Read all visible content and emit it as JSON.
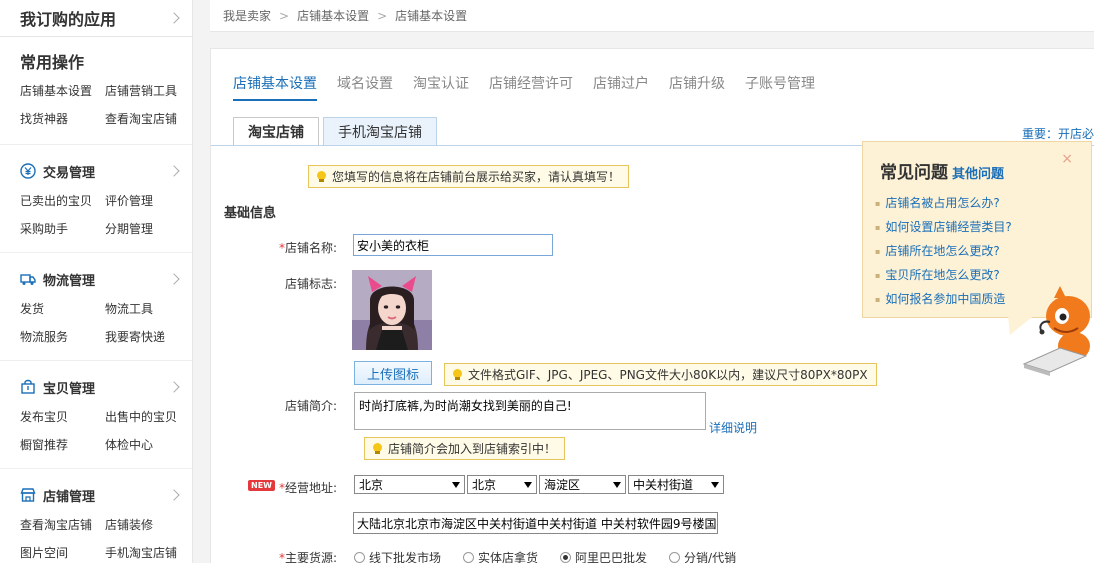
{
  "sidebar": {
    "top_title": "我订购的应用",
    "common_title": "常用操作",
    "common_links": [
      "店铺基本设置",
      "店铺营销工具",
      "找货神器",
      "查看淘宝店铺"
    ],
    "groups": [
      {
        "title": "交易管理",
        "icon": "yen-icon",
        "links": [
          "已卖出的宝贝",
          "评价管理",
          "采购助手",
          "分期管理"
        ]
      },
      {
        "title": "物流管理",
        "icon": "truck-icon",
        "links": [
          "发货",
          "物流工具",
          "物流服务",
          "我要寄快递"
        ]
      },
      {
        "title": "宝贝管理",
        "icon": "bag-icon",
        "links": [
          "发布宝贝",
          "出售中的宝贝",
          "橱窗推荐",
          "体检中心"
        ]
      },
      {
        "title": "店铺管理",
        "icon": "shop-icon",
        "links": [
          "查看淘宝店铺",
          "店铺装修",
          "图片空间",
          "手机淘宝店铺"
        ]
      }
    ]
  },
  "breadcrumb": [
    "我是卖家",
    "店铺基本设置",
    "店铺基本设置"
  ],
  "breadcrumb_sep": ">",
  "tabs": [
    "店铺基本设置",
    "域名设置",
    "淘宝认证",
    "店铺经营许可",
    "店铺过户",
    "店铺升级",
    "子账号管理"
  ],
  "subtabs": [
    "淘宝店铺",
    "手机淘宝店铺"
  ],
  "important_text": "重要：开店必",
  "info_tip": "您填写的信息将在店铺前台展示给买家，请认真填写！",
  "section_title": "基础信息",
  "form": {
    "shop_name_label": "店铺名称:",
    "shop_name_value": "安小美的衣柜",
    "shop_logo_label": "店铺标志:",
    "upload_button": "上传图标",
    "upload_tip": "文件格式GIF、JPG、JPEG、PNG文件大小80K以内，建议尺寸80PX*80PX",
    "intro_label": "店铺简介:",
    "intro_value": "时尚打底裤,为时尚潮女找到美丽的自己!",
    "detail_link": "详细说明",
    "intro_tip": "店铺简介会加入到店铺索引中！",
    "new_badge": "NEW",
    "address_label": "经营地址:",
    "address_selects": [
      "北京",
      "北京",
      "海淀区",
      "中关村街道"
    ],
    "address_full": "大陆北京北京市海淀区中关村街道中关村街道 中关村软件园9号楼国",
    "source_label": "主要货源:",
    "source_options": [
      "线下批发市场",
      "实体店拿货",
      "阿里巴巴批发",
      "分销/代销"
    ],
    "source_selected": 2,
    "required_mark": "*"
  },
  "faq": {
    "title": "常见问题",
    "other": "其他问题",
    "close": "×",
    "items": [
      "店铺名被占用怎么办?",
      "如何设置店铺经营类目?",
      "店铺所在地怎么更改?",
      "宝贝所在地怎么更改?",
      "如何报名参加中国质造"
    ]
  },
  "colors": {
    "accent": "#1a6fb8",
    "required": "#e4393c",
    "tip_border": "#e8c45d",
    "faq_bg": "#fdf1d6"
  }
}
